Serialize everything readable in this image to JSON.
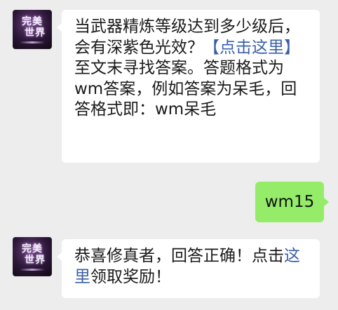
{
  "colors": {
    "background": "#ededed",
    "incoming_bubble": "#ffffff",
    "outgoing_bubble": "#95ec69",
    "link": "#3a5fa8",
    "text": "#1a1a1a"
  },
  "avatar": {
    "logo_line1": "完美",
    "logo_line2": "世界"
  },
  "messages": [
    {
      "sender": "official",
      "text_parts": [
        "当武器精炼等级达到多少级后，会有深紫色光效？",
        "【点击这里】",
        "至文末寻找答案。答题格式为wm答案，例如答案为呆毛，回答格式即：wm呆毛"
      ]
    },
    {
      "sender": "user",
      "text": "wm15"
    },
    {
      "sender": "official",
      "text_parts": [
        "恭喜修真者，回答正确！点击",
        "这里",
        "领取奖励！"
      ]
    }
  ]
}
